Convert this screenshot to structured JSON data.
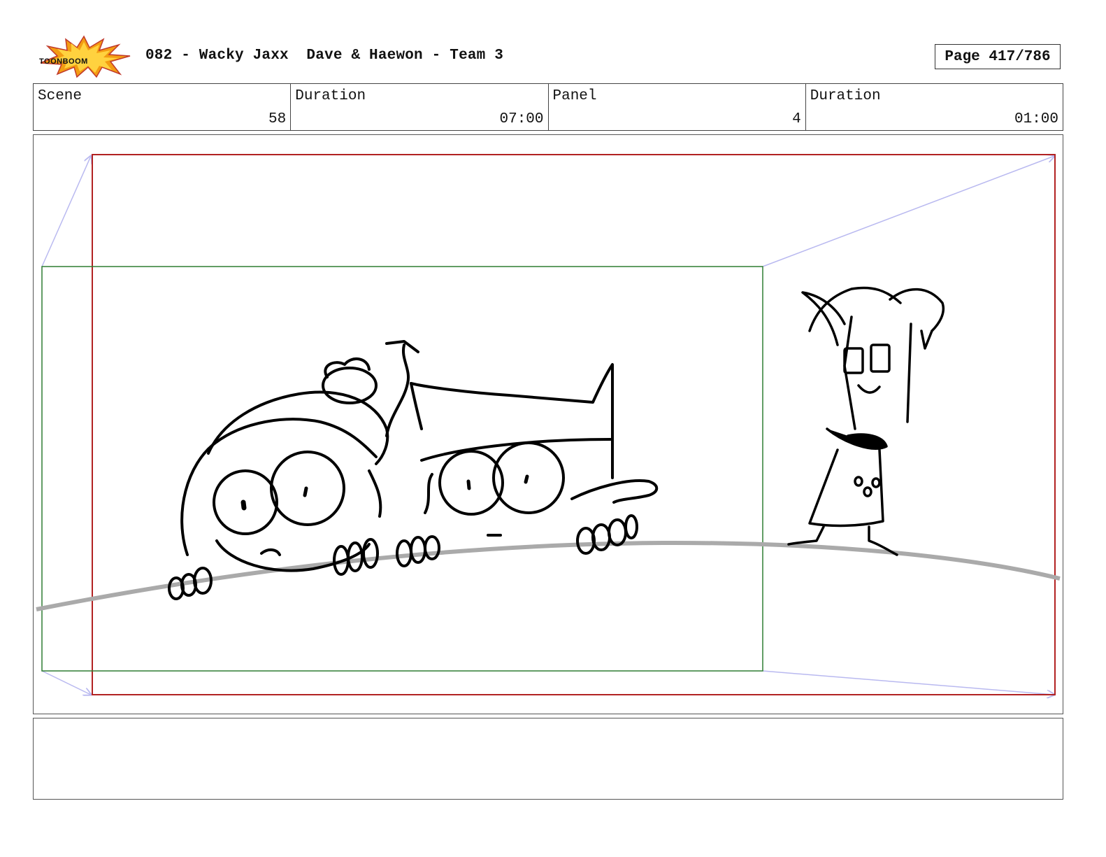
{
  "header": {
    "logo_text": "TOONBOOM",
    "title": "082 - Wacky Jaxx  Dave & Haewon - Team 3",
    "page_label": "Page 417/786"
  },
  "info": {
    "scene_label": "Scene",
    "scene_value": "58",
    "scene_duration_label": "Duration",
    "scene_duration_value": "07:00",
    "panel_label": "Panel",
    "panel_value": "4",
    "panel_duration_label": "Duration",
    "panel_duration_value": "01:00"
  },
  "colors": {
    "camera_end_frame": "#b22222",
    "camera_start_frame": "#2e7d32",
    "camera_move_arrows": "#b9b9f0",
    "ground_line": "#aaaaaa",
    "logo_burst": "#f39c12"
  },
  "notes": {
    "text": ""
  }
}
